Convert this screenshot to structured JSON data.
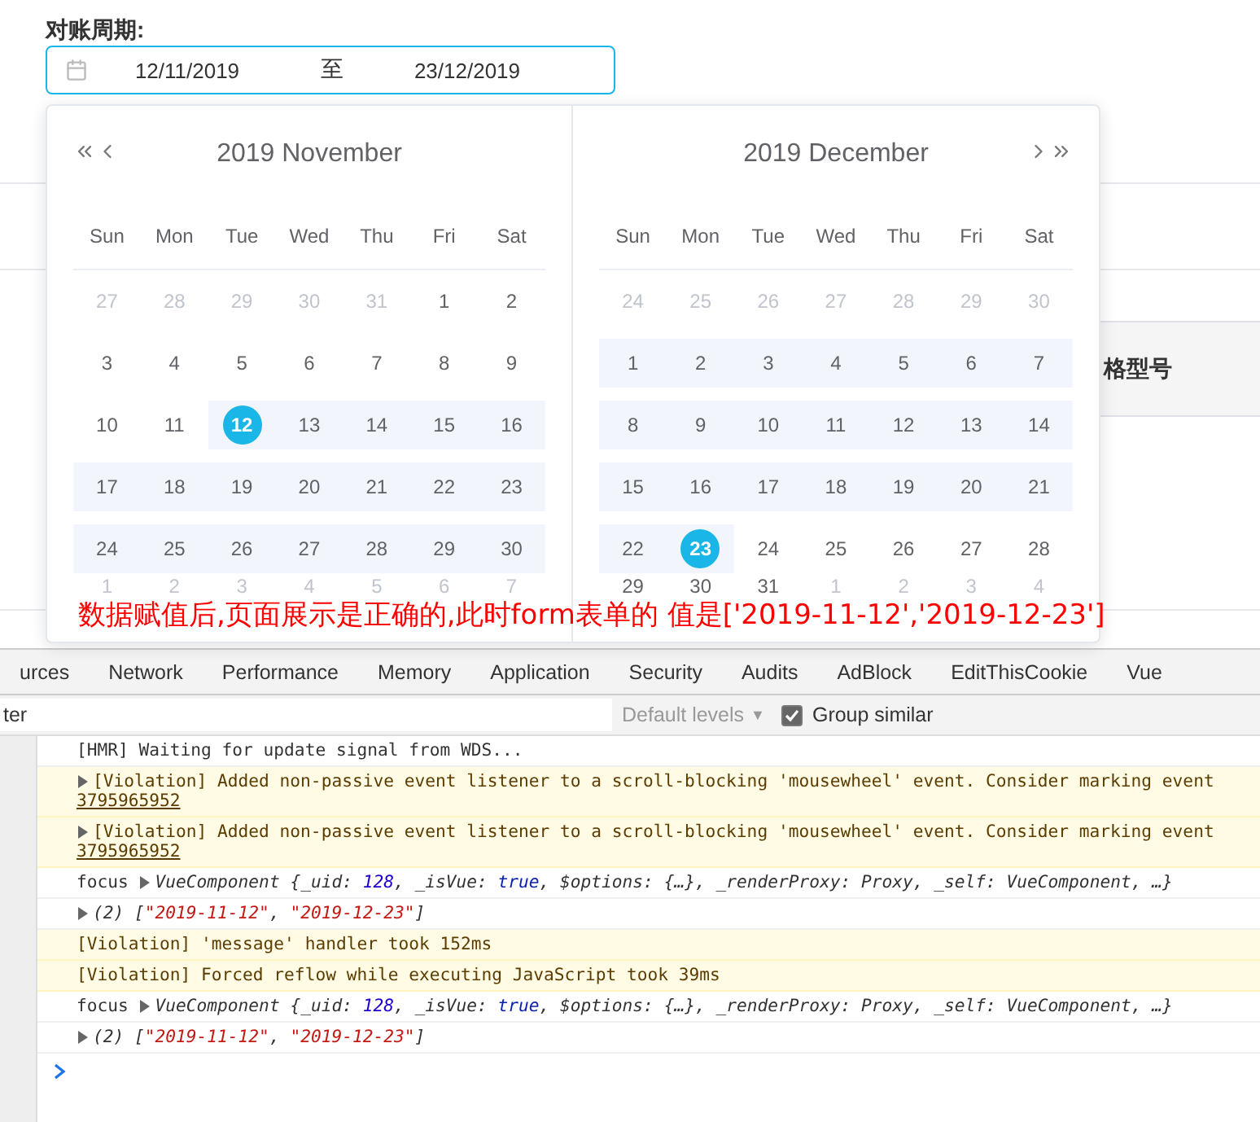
{
  "form": {
    "label": "对账周期:",
    "range": {
      "start": "12/11/2019",
      "separator": "至",
      "end": "23/12/2019"
    }
  },
  "background_table": {
    "header": "格型号"
  },
  "calendars": [
    {
      "title": "2019 November",
      "weekdays": [
        "Sun",
        "Mon",
        "Tue",
        "Wed",
        "Thu",
        "Fri",
        "Sat"
      ],
      "weeks": [
        [
          {
            "label": "27",
            "muted": true,
            "in_range": false,
            "selected": false
          },
          {
            "label": "28",
            "muted": true,
            "in_range": false,
            "selected": false
          },
          {
            "label": "29",
            "muted": true,
            "in_range": false,
            "selected": false
          },
          {
            "label": "30",
            "muted": true,
            "in_range": false,
            "selected": false
          },
          {
            "label": "31",
            "muted": true,
            "in_range": false,
            "selected": false
          },
          {
            "label": "1",
            "muted": false,
            "in_range": false,
            "selected": false
          },
          {
            "label": "2",
            "muted": false,
            "in_range": false,
            "selected": false
          }
        ],
        [
          {
            "label": "3",
            "muted": false,
            "in_range": false,
            "selected": false
          },
          {
            "label": "4",
            "muted": false,
            "in_range": false,
            "selected": false
          },
          {
            "label": "5",
            "muted": false,
            "in_range": false,
            "selected": false
          },
          {
            "label": "6",
            "muted": false,
            "in_range": false,
            "selected": false
          },
          {
            "label": "7",
            "muted": false,
            "in_range": false,
            "selected": false
          },
          {
            "label": "8",
            "muted": false,
            "in_range": false,
            "selected": false
          },
          {
            "label": "9",
            "muted": false,
            "in_range": false,
            "selected": false
          }
        ],
        [
          {
            "label": "10",
            "muted": false,
            "in_range": false,
            "selected": false
          },
          {
            "label": "11",
            "muted": false,
            "in_range": false,
            "selected": false
          },
          {
            "label": "12",
            "muted": false,
            "in_range": true,
            "selected": true
          },
          {
            "label": "13",
            "muted": false,
            "in_range": true,
            "selected": false
          },
          {
            "label": "14",
            "muted": false,
            "in_range": true,
            "selected": false
          },
          {
            "label": "15",
            "muted": false,
            "in_range": true,
            "selected": false
          },
          {
            "label": "16",
            "muted": false,
            "in_range": true,
            "selected": false
          }
        ],
        [
          {
            "label": "17",
            "muted": false,
            "in_range": true,
            "selected": false
          },
          {
            "label": "18",
            "muted": false,
            "in_range": true,
            "selected": false
          },
          {
            "label": "19",
            "muted": false,
            "in_range": true,
            "selected": false
          },
          {
            "label": "20",
            "muted": false,
            "in_range": true,
            "selected": false
          },
          {
            "label": "21",
            "muted": false,
            "in_range": true,
            "selected": false
          },
          {
            "label": "22",
            "muted": false,
            "in_range": true,
            "selected": false
          },
          {
            "label": "23",
            "muted": false,
            "in_range": true,
            "selected": false
          }
        ],
        [
          {
            "label": "24",
            "muted": false,
            "in_range": true,
            "selected": false
          },
          {
            "label": "25",
            "muted": false,
            "in_range": true,
            "selected": false
          },
          {
            "label": "26",
            "muted": false,
            "in_range": true,
            "selected": false
          },
          {
            "label": "27",
            "muted": false,
            "in_range": true,
            "selected": false
          },
          {
            "label": "28",
            "muted": false,
            "in_range": true,
            "selected": false
          },
          {
            "label": "29",
            "muted": false,
            "in_range": true,
            "selected": false
          },
          {
            "label": "30",
            "muted": false,
            "in_range": true,
            "selected": false
          }
        ],
        [
          {
            "label": "1",
            "muted": true,
            "in_range": false,
            "selected": false
          },
          {
            "label": "2",
            "muted": true,
            "in_range": false,
            "selected": false
          },
          {
            "label": "3",
            "muted": true,
            "in_range": false,
            "selected": false
          },
          {
            "label": "4",
            "muted": true,
            "in_range": false,
            "selected": false
          },
          {
            "label": "5",
            "muted": true,
            "in_range": false,
            "selected": false
          },
          {
            "label": "6",
            "muted": true,
            "in_range": false,
            "selected": false
          },
          {
            "label": "7",
            "muted": true,
            "in_range": false,
            "selected": false
          }
        ]
      ]
    },
    {
      "title": "2019 December",
      "weekdays": [
        "Sun",
        "Mon",
        "Tue",
        "Wed",
        "Thu",
        "Fri",
        "Sat"
      ],
      "weeks": [
        [
          {
            "label": "24",
            "muted": true,
            "in_range": false,
            "selected": false
          },
          {
            "label": "25",
            "muted": true,
            "in_range": false,
            "selected": false
          },
          {
            "label": "26",
            "muted": true,
            "in_range": false,
            "selected": false
          },
          {
            "label": "27",
            "muted": true,
            "in_range": false,
            "selected": false
          },
          {
            "label": "28",
            "muted": true,
            "in_range": false,
            "selected": false
          },
          {
            "label": "29",
            "muted": true,
            "in_range": false,
            "selected": false
          },
          {
            "label": "30",
            "muted": true,
            "in_range": false,
            "selected": false
          }
        ],
        [
          {
            "label": "1",
            "muted": false,
            "in_range": true,
            "selected": false
          },
          {
            "label": "2",
            "muted": false,
            "in_range": true,
            "selected": false
          },
          {
            "label": "3",
            "muted": false,
            "in_range": true,
            "selected": false
          },
          {
            "label": "4",
            "muted": false,
            "in_range": true,
            "selected": false
          },
          {
            "label": "5",
            "muted": false,
            "in_range": true,
            "selected": false
          },
          {
            "label": "6",
            "muted": false,
            "in_range": true,
            "selected": false
          },
          {
            "label": "7",
            "muted": false,
            "in_range": true,
            "selected": false
          }
        ],
        [
          {
            "label": "8",
            "muted": false,
            "in_range": true,
            "selected": false
          },
          {
            "label": "9",
            "muted": false,
            "in_range": true,
            "selected": false
          },
          {
            "label": "10",
            "muted": false,
            "in_range": true,
            "selected": false
          },
          {
            "label": "11",
            "muted": false,
            "in_range": true,
            "selected": false
          },
          {
            "label": "12",
            "muted": false,
            "in_range": true,
            "selected": false
          },
          {
            "label": "13",
            "muted": false,
            "in_range": true,
            "selected": false
          },
          {
            "label": "14",
            "muted": false,
            "in_range": true,
            "selected": false
          }
        ],
        [
          {
            "label": "15",
            "muted": false,
            "in_range": true,
            "selected": false
          },
          {
            "label": "16",
            "muted": false,
            "in_range": true,
            "selected": false
          },
          {
            "label": "17",
            "muted": false,
            "in_range": true,
            "selected": false
          },
          {
            "label": "18",
            "muted": false,
            "in_range": true,
            "selected": false
          },
          {
            "label": "19",
            "muted": false,
            "in_range": true,
            "selected": false
          },
          {
            "label": "20",
            "muted": false,
            "in_range": true,
            "selected": false
          },
          {
            "label": "21",
            "muted": false,
            "in_range": true,
            "selected": false
          }
        ],
        [
          {
            "label": "22",
            "muted": false,
            "in_range": true,
            "selected": false
          },
          {
            "label": "23",
            "muted": false,
            "in_range": true,
            "selected": true
          },
          {
            "label": "24",
            "muted": false,
            "in_range": false,
            "selected": false
          },
          {
            "label": "25",
            "muted": false,
            "in_range": false,
            "selected": false
          },
          {
            "label": "26",
            "muted": false,
            "in_range": false,
            "selected": false
          },
          {
            "label": "27",
            "muted": false,
            "in_range": false,
            "selected": false
          },
          {
            "label": "28",
            "muted": false,
            "in_range": false,
            "selected": false
          }
        ],
        [
          {
            "label": "29",
            "muted": false,
            "in_range": false,
            "selected": false
          },
          {
            "label": "30",
            "muted": false,
            "in_range": false,
            "selected": false
          },
          {
            "label": "31",
            "muted": false,
            "in_range": false,
            "selected": false
          },
          {
            "label": "1",
            "muted": true,
            "in_range": false,
            "selected": false
          },
          {
            "label": "2",
            "muted": true,
            "in_range": false,
            "selected": false
          },
          {
            "label": "3",
            "muted": true,
            "in_range": false,
            "selected": false
          },
          {
            "label": "4",
            "muted": true,
            "in_range": false,
            "selected": false
          }
        ]
      ]
    }
  ],
  "annotation": "数据赋值后,页面展示是正确的,此时form表单的 值是['2019-11-12','2019-12-23']",
  "devtools": {
    "tabs": [
      {
        "label": "urces",
        "selected": false
      },
      {
        "label": "Network",
        "selected": false
      },
      {
        "label": "Performance",
        "selected": false
      },
      {
        "label": "Memory",
        "selected": false
      },
      {
        "label": "Application",
        "selected": false
      },
      {
        "label": "Security",
        "selected": false
      },
      {
        "label": "Audits",
        "selected": false
      },
      {
        "label": "AdBlock",
        "selected": false
      },
      {
        "label": "EditThisCookie",
        "selected": false
      },
      {
        "label": "Vue",
        "selected": false
      }
    ],
    "filter": {
      "placeholder": "ter"
    },
    "levels": {
      "label": "Default levels",
      "arrow": "▼"
    },
    "group_similar": {
      "label": "Group similar",
      "checked": true
    },
    "messages": [
      {
        "kind": "log",
        "expander": false,
        "parts": [
          {
            "text": "[HMR] Waiting for update signal from WDS...",
            "kind": "plain"
          }
        ]
      },
      {
        "kind": "warning",
        "expander": true,
        "parts": [
          {
            "text": "[Violation] Added non-passive event listener to a scroll-blocking 'mousewheel' event. Consider marking event",
            "kind": "plain"
          }
        ],
        "link": "3795965952"
      },
      {
        "kind": "warning",
        "expander": true,
        "parts": [
          {
            "text": "[Violation] Added non-passive event listener to a scroll-blocking 'mousewheel' event. Consider marking event",
            "kind": "plain"
          }
        ],
        "link": "3795965952"
      },
      {
        "kind": "log",
        "expander": true,
        "prefix": "focus",
        "parts": [
          {
            "text": "VueComponent {_uid: ",
            "kind": "italic"
          },
          {
            "text": "128",
            "kind": "number"
          },
          {
            "text": ", _isVue: ",
            "kind": "italic"
          },
          {
            "text": "true",
            "kind": "keyword"
          },
          {
            "text": ", $options: {…}, _renderProxy: Proxy, _self: VueComponent, …}",
            "kind": "italic"
          }
        ]
      },
      {
        "kind": "log",
        "expander": true,
        "parts": [
          {
            "text": "(2) [",
            "kind": "italic"
          },
          {
            "text": "\"2019-11-12\"",
            "kind": "string"
          },
          {
            "text": ", ",
            "kind": "italic"
          },
          {
            "text": "\"2019-12-23\"",
            "kind": "string"
          },
          {
            "text": "]",
            "kind": "italic"
          }
        ]
      },
      {
        "kind": "warning",
        "expander": false,
        "parts": [
          {
            "text": "[Violation] 'message' handler took 152ms",
            "kind": "plain"
          }
        ]
      },
      {
        "kind": "warning",
        "expander": false,
        "parts": [
          {
            "text": "[Violation] Forced reflow while executing JavaScript took 39ms",
            "kind": "plain"
          }
        ]
      },
      {
        "kind": "log",
        "expander": true,
        "prefix": "focus",
        "parts": [
          {
            "text": "VueComponent {_uid: ",
            "kind": "italic"
          },
          {
            "text": "128",
            "kind": "number"
          },
          {
            "text": ", _isVue: ",
            "kind": "italic"
          },
          {
            "text": "true",
            "kind": "keyword"
          },
          {
            "text": ", $options: {…}, _renderProxy: Proxy, _self: VueComponent, …}",
            "kind": "italic"
          }
        ]
      },
      {
        "kind": "log",
        "expander": true,
        "parts": [
          {
            "text": "(2) [",
            "kind": "italic"
          },
          {
            "text": "\"2019-11-12\"",
            "kind": "string"
          },
          {
            "text": ", ",
            "kind": "italic"
          },
          {
            "text": "\"2019-12-23\"",
            "kind": "string"
          },
          {
            "text": "]",
            "kind": "italic"
          }
        ]
      }
    ]
  }
}
